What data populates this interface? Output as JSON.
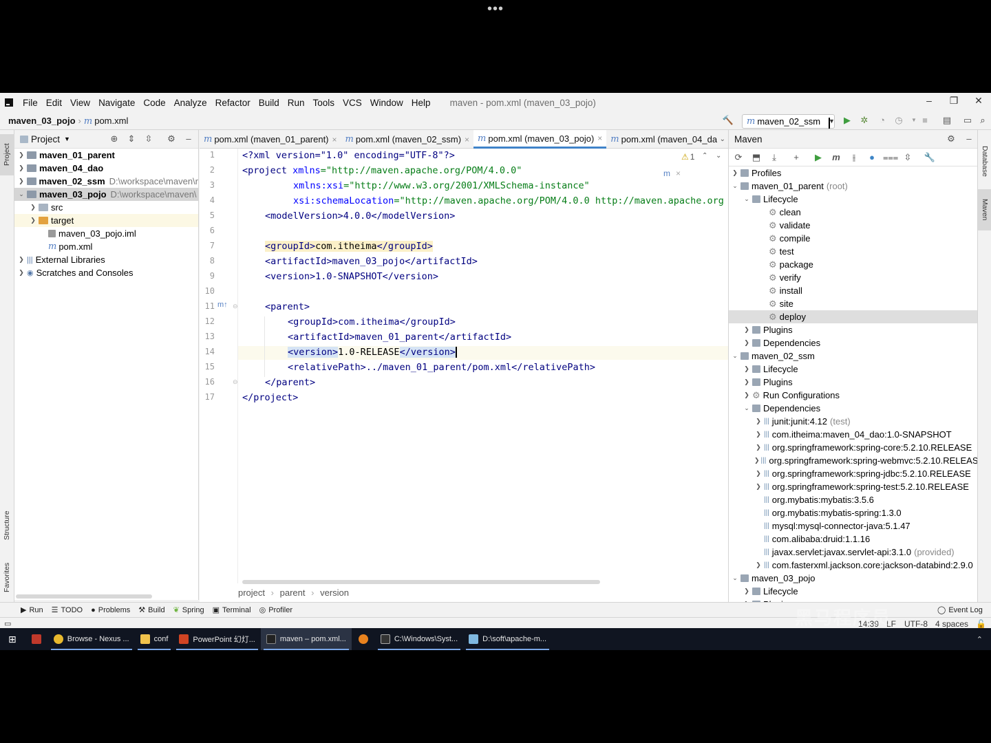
{
  "menu": {
    "items": [
      "File",
      "Edit",
      "View",
      "Navigate",
      "Code",
      "Analyze",
      "Refactor",
      "Build",
      "Run",
      "Tools",
      "VCS",
      "Window",
      "Help"
    ],
    "window_title": "maven - pom.xml (maven_03_pojo)"
  },
  "navbar": {
    "project": "maven_03_pojo",
    "file": "pom.xml",
    "run_config": "maven_02_ssm"
  },
  "left_strip": {
    "project": "Project",
    "structure": "Structure",
    "favorites": "Favorites"
  },
  "project_panel": {
    "title": "Project",
    "rows": [
      {
        "label": "maven_01_parent",
        "path": ""
      },
      {
        "label": "maven_04_dao",
        "path": ""
      },
      {
        "label": "maven_02_ssm",
        "path": "D:\\workspace\\maven\\r"
      },
      {
        "label": "maven_03_pojo",
        "path": "D:\\workspace\\maven\\"
      },
      {
        "label": "src",
        "path": ""
      },
      {
        "label": "target",
        "path": ""
      },
      {
        "label": "maven_03_pojo.iml",
        "path": ""
      },
      {
        "label": "pom.xml",
        "path": ""
      },
      {
        "label": "External Libraries",
        "path": ""
      },
      {
        "label": "Scratches and Consoles",
        "path": ""
      }
    ]
  },
  "editor": {
    "tabs": [
      "pom.xml (maven_01_parent)",
      "pom.xml (maven_02_ssm)",
      "pom.xml (maven_03_pojo)",
      "pom.xml (maven_04_dao"
    ],
    "warning_count": "1",
    "line_numbers": [
      "1",
      "2",
      "3",
      "4",
      "5",
      "6",
      "7",
      "8",
      "9",
      "10",
      "11",
      "12",
      "13",
      "14",
      "15",
      "16",
      "17"
    ],
    "lines": {
      "l1": "<?xml version=\"1.0\" encoding=\"UTF-8\"?>",
      "l2a": "<project ",
      "l2b": "xmlns",
      "l2c": "=\"http://maven.apache.org/POM/4.0.0\"",
      "l3a": "xmlns:xsi",
      "l3b": "=\"http://www.w3.org/2001/XMLSchema-instance\"",
      "l4a": "xsi:schemaLocation",
      "l4b": "=\"http://maven.apache.org/POM/4.0.0 http://maven.apache.org",
      "l5": "<modelVersion>4.0.0</modelVersion>",
      "l7a": "<groupId>",
      "l7b": "com.itheima",
      "l7c": "</groupId>",
      "l8": "<artifactId>maven_03_pojo</artifactId>",
      "l9": "<version>1.0-SNAPSHOT</version>",
      "l11": "<parent>",
      "l12": "<groupId>com.itheima</groupId>",
      "l13": "<artifactId>maven_01_parent</artifactId>",
      "l14a": "<version>",
      "l14b": "1.0-RELEASE",
      "l14c": "</version>",
      "l15": "<relativePath>../maven_01_parent/pom.xml</relativePath>",
      "l16": "</parent>",
      "l17": "</project>"
    },
    "breadcrumb": [
      "project",
      "parent",
      "version"
    ]
  },
  "maven": {
    "title": "Maven",
    "rows": [
      {
        "label": "Profiles",
        "note": ""
      },
      {
        "label": "maven_01_parent",
        "note": "(root)"
      },
      {
        "label": "Lifecycle",
        "note": ""
      },
      {
        "label": "clean",
        "note": ""
      },
      {
        "label": "validate",
        "note": ""
      },
      {
        "label": "compile",
        "note": ""
      },
      {
        "label": "test",
        "note": ""
      },
      {
        "label": "package",
        "note": ""
      },
      {
        "label": "verify",
        "note": ""
      },
      {
        "label": "install",
        "note": ""
      },
      {
        "label": "site",
        "note": ""
      },
      {
        "label": "deploy",
        "note": ""
      },
      {
        "label": "Plugins",
        "note": ""
      },
      {
        "label": "Dependencies",
        "note": ""
      },
      {
        "label": "maven_02_ssm",
        "note": ""
      },
      {
        "label": "Lifecycle",
        "note": ""
      },
      {
        "label": "Plugins",
        "note": ""
      },
      {
        "label": "Run Configurations",
        "note": ""
      },
      {
        "label": "Dependencies",
        "note": ""
      },
      {
        "label": "junit:junit:4.12",
        "note": "(test)"
      },
      {
        "label": "com.itheima:maven_04_dao:1.0-SNAPSHOT",
        "note": ""
      },
      {
        "label": "org.springframework:spring-core:5.2.10.RELEASE",
        "note": ""
      },
      {
        "label": "org.springframework:spring-webmvc:5.2.10.RELEAS",
        "note": ""
      },
      {
        "label": "org.springframework:spring-jdbc:5.2.10.RELEASE",
        "note": ""
      },
      {
        "label": "org.springframework:spring-test:5.2.10.RELEASE",
        "note": ""
      },
      {
        "label": "org.mybatis:mybatis:3.5.6",
        "note": ""
      },
      {
        "label": "org.mybatis:mybatis-spring:1.3.0",
        "note": ""
      },
      {
        "label": "mysql:mysql-connector-java:5.1.47",
        "note": ""
      },
      {
        "label": "com.alibaba:druid:1.1.16",
        "note": ""
      },
      {
        "label": "javax.servlet:javax.servlet-api:3.1.0",
        "note": "(provided)"
      },
      {
        "label": "com.fasterxml.jackson.core:jackson-databind:2.9.0",
        "note": ""
      },
      {
        "label": "maven_03_pojo",
        "note": ""
      },
      {
        "label": "Lifecycle",
        "note": ""
      },
      {
        "label": "Plugins",
        "note": ""
      }
    ]
  },
  "right_strip": {
    "database": "Database",
    "maven": "Maven"
  },
  "toolwindows": [
    "Run",
    "TODO",
    "Problems",
    "Build",
    "Spring",
    "Terminal",
    "Profiler"
  ],
  "event_log": "Event Log",
  "status": {
    "position": "14:39",
    "line_sep": "LF",
    "encoding": "UTF-8",
    "indent": "4 spaces"
  },
  "taskbar": {
    "items": [
      "Browse - Nexus ...",
      "conf",
      "PowerPoint 幻灯...",
      "maven – pom.xml...",
      "C:\\Windows\\Syst...",
      "D:\\soft\\apache-m..."
    ]
  },
  "watermark": "黑马程序员"
}
